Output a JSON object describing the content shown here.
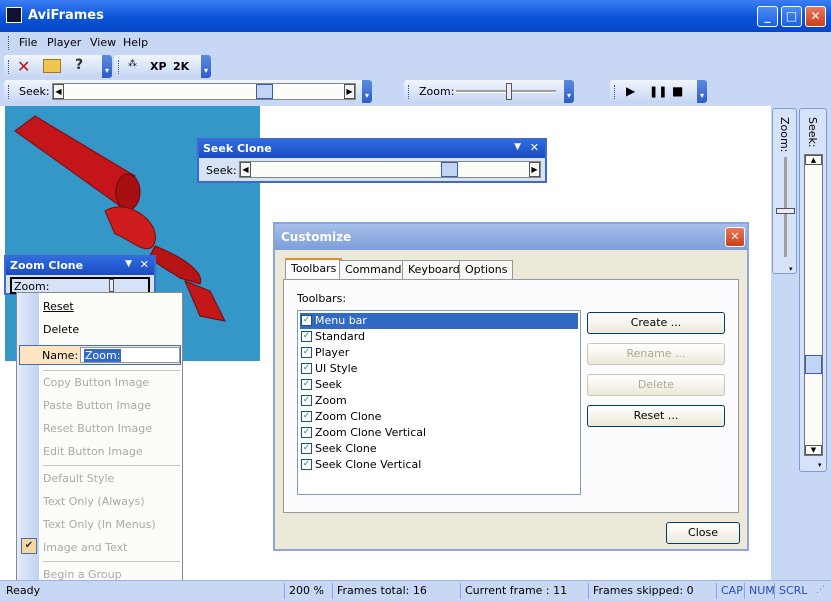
{
  "window": {
    "title": "AviFrames"
  },
  "menu": [
    "File",
    "Player",
    "View",
    "Help"
  ],
  "toolbar": {
    "xp_label": "XP",
    "k2_label": "2K",
    "seek_label": "Seek:",
    "zoom_label": "Zoom:"
  },
  "seek_clone": {
    "title": "Seek Clone",
    "label": "Seek:"
  },
  "zoom_clone": {
    "title": "Zoom Clone",
    "label": "Zoom:"
  },
  "vertical": {
    "zoom_label": "Zoom:",
    "seek_label": "Seek:"
  },
  "context_menu": {
    "reset": "Reset",
    "delete": "Delete",
    "name_label": "Name:",
    "name_value": "Zoom:",
    "copy_image": "Copy Button Image",
    "paste_image": "Paste Button Image",
    "reset_image": "Reset Button Image",
    "edit_image": "Edit Button Image",
    "default_style": "Default Style",
    "text_only_always": "Text Only (Always)",
    "text_only_menus": "Text Only (In Menus)",
    "image_and_text": "Image and Text",
    "begin_group": "Begin a Group"
  },
  "customize": {
    "title": "Customize",
    "tabs": [
      "Toolbars",
      "Commands",
      "Keyboard",
      "Options"
    ],
    "toolbars_label": "Toolbars:",
    "toolbars": [
      "Menu bar",
      "Standard",
      "Player",
      "UI Style",
      "Seek",
      "Zoom",
      "Zoom Clone",
      "Zoom Clone Vertical",
      "Seek Clone",
      "Seek Clone Vertical"
    ],
    "create": "Create ...",
    "rename": "Rename ...",
    "delete": "Delete",
    "reset": "Reset ...",
    "close": "Close"
  },
  "status": {
    "ready": "Ready",
    "zoom": "200 %",
    "frames_total": "Frames total:  16",
    "current_frame": "Current frame :  11",
    "frames_skipped": "Frames skipped:  0",
    "cap": "CAP",
    "num": "NUM",
    "scrl": "SCRL"
  },
  "colors": {
    "title_blue": "#0a54d8",
    "accent_orange": "#e68b2c",
    "image_bg": "#3497c7",
    "ribbon_red": "#c4161a"
  }
}
